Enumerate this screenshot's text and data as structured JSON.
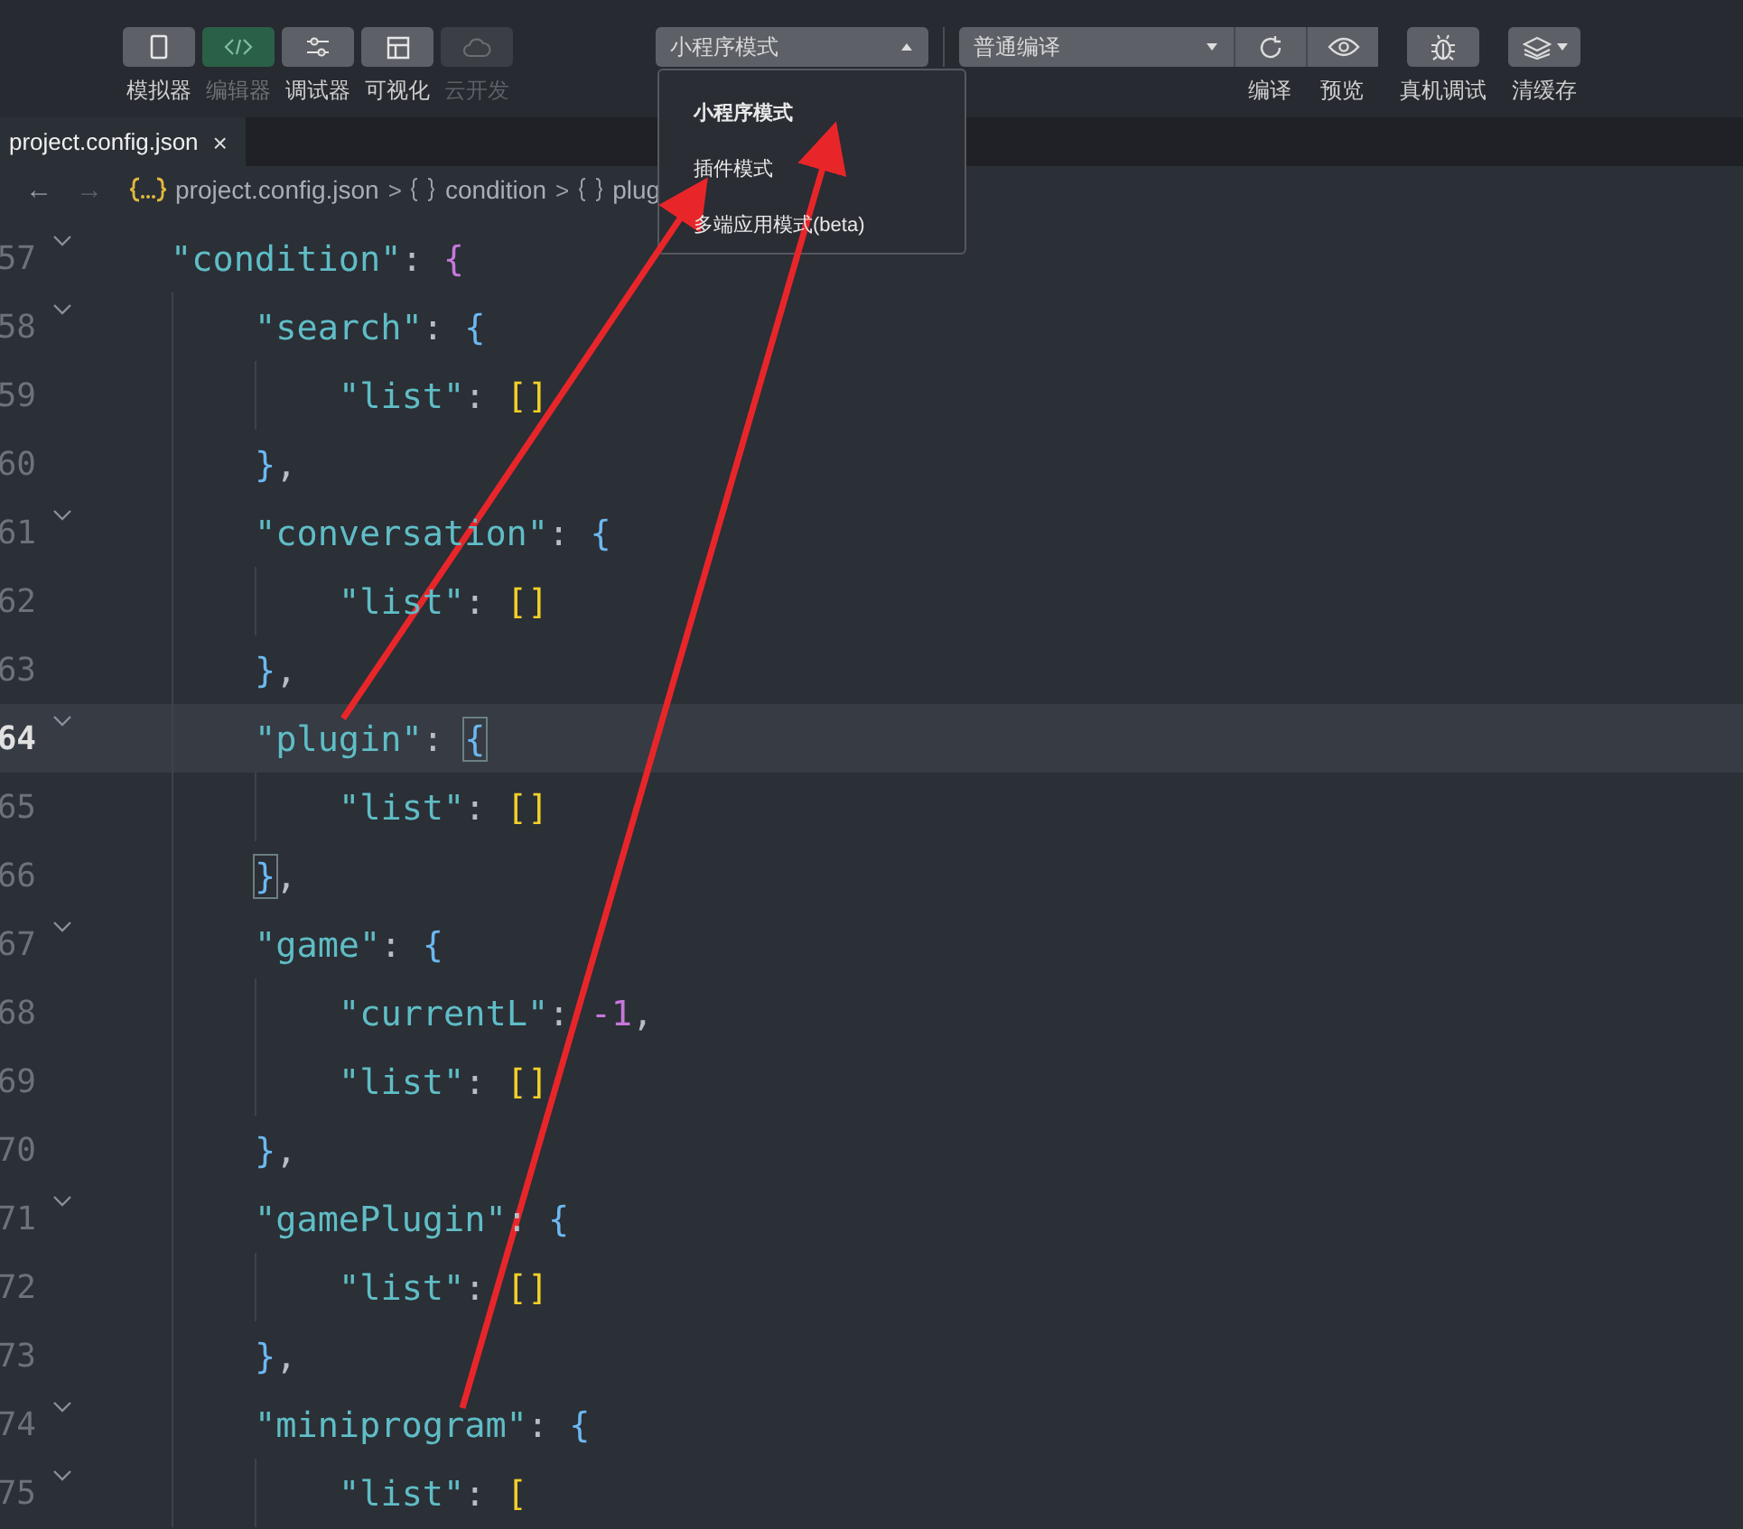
{
  "toolbar": {
    "view_buttons": [
      {
        "label": "模拟器",
        "on": false,
        "disabled": false
      },
      {
        "label": "编辑器",
        "on": true,
        "disabled": false
      },
      {
        "label": "调试器",
        "on": false,
        "disabled": false
      },
      {
        "label": "可视化",
        "on": false,
        "disabled": false
      },
      {
        "label": "云开发",
        "on": false,
        "disabled": true
      }
    ],
    "mode_select": {
      "value": "小程序模式",
      "expanded": true
    },
    "compile_select": {
      "value": "普通编译"
    },
    "actions": [
      {
        "label": "编译"
      },
      {
        "label": "预览"
      },
      {
        "label": "真机调试"
      },
      {
        "label": "清缓存"
      }
    ]
  },
  "mode_menu": {
    "items": [
      {
        "label": "小程序模式",
        "selected": true
      },
      {
        "label": "插件模式",
        "selected": false
      },
      {
        "label": "多端应用模式(beta)",
        "selected": false
      }
    ]
  },
  "tabs": [
    {
      "label": "project.config.json",
      "selected": true,
      "close": "×"
    }
  ],
  "breadcrumb": {
    "back": "←",
    "forward": "→",
    "items": [
      {
        "kind": "file",
        "label": "project.config.json"
      },
      {
        "kind": "object",
        "label": "condition"
      },
      {
        "kind": "object",
        "label": "plug"
      }
    ],
    "separator": ">"
  },
  "editor": {
    "lines": [
      {
        "number": "57",
        "fold": true,
        "current": false,
        "tokens": [
          {
            "kind": "key",
            "text": "\"condition\""
          },
          {
            "kind": "punct",
            "text": ": "
          },
          {
            "kind": "brace",
            "text": "{",
            "color": "#c678dd",
            "matched": false
          }
        ],
        "children": [
          {
            "number": "58",
            "fold": true,
            "current": false,
            "tokens": [
              {
                "kind": "key",
                "text": "\"search\""
              },
              {
                "kind": "punct",
                "text": ": "
              },
              {
                "kind": "brace",
                "text": "{",
                "color": "#6cb8f0",
                "matched": false
              }
            ],
            "children": [
              {
                "number": "59",
                "fold": false,
                "current": false,
                "tokens": [
                  {
                    "kind": "key",
                    "text": "\"list\""
                  },
                  {
                    "kind": "punct",
                    "text": ": "
                  },
                  {
                    "kind": "brace",
                    "text": "[]",
                    "color": "#f2d02a",
                    "matched": false
                  }
                ]
              }
            ]
          },
          {
            "number": "60",
            "fold": false,
            "current": false,
            "tokens": [
              {
                "kind": "brace",
                "text": "}",
                "color": "#6cb8f0",
                "matched": false
              },
              {
                "kind": "punct",
                "text": ","
              }
            ]
          },
          {
            "number": "61",
            "fold": true,
            "current": false,
            "tokens": [
              {
                "kind": "key",
                "text": "\"conversation\""
              },
              {
                "kind": "punct",
                "text": ": "
              },
              {
                "kind": "brace",
                "text": "{",
                "color": "#6cb8f0",
                "matched": false
              }
            ],
            "children": [
              {
                "number": "62",
                "fold": false,
                "current": false,
                "tokens": [
                  {
                    "kind": "key",
                    "text": "\"list\""
                  },
                  {
                    "kind": "punct",
                    "text": ": "
                  },
                  {
                    "kind": "brace",
                    "text": "[]",
                    "color": "#f2d02a",
                    "matched": false
                  }
                ]
              }
            ]
          },
          {
            "number": "63",
            "fold": false,
            "current": false,
            "tokens": [
              {
                "kind": "brace",
                "text": "}",
                "color": "#6cb8f0",
                "matched": false
              },
              {
                "kind": "punct",
                "text": ","
              }
            ]
          },
          {
            "number": "64",
            "fold": true,
            "current": true,
            "tokens": [
              {
                "kind": "key",
                "text": "\"plugin\""
              },
              {
                "kind": "punct",
                "text": ": "
              },
              {
                "kind": "brace",
                "text": "{",
                "color": "#6cb8f0",
                "matched": true
              }
            ],
            "children": [
              {
                "number": "65",
                "fold": false,
                "current": false,
                "tokens": [
                  {
                    "kind": "key",
                    "text": "\"list\""
                  },
                  {
                    "kind": "punct",
                    "text": ": "
                  },
                  {
                    "kind": "brace",
                    "text": "[]",
                    "color": "#f2d02a",
                    "matched": false
                  }
                ]
              }
            ]
          },
          {
            "number": "66",
            "fold": false,
            "current": false,
            "tokens": [
              {
                "kind": "brace",
                "text": "}",
                "color": "#6cb8f0",
                "matched": true
              },
              {
                "kind": "punct",
                "text": ","
              }
            ]
          },
          {
            "number": "67",
            "fold": true,
            "current": false,
            "tokens": [
              {
                "kind": "key",
                "text": "\"game\""
              },
              {
                "kind": "punct",
                "text": ": "
              },
              {
                "kind": "brace",
                "text": "{",
                "color": "#6cb8f0",
                "matched": false
              }
            ],
            "children": [
              {
                "number": "68",
                "fold": false,
                "current": false,
                "tokens": [
                  {
                    "kind": "key",
                    "text": "\"currentL\""
                  },
                  {
                    "kind": "punct",
                    "text": ": "
                  },
                  {
                    "kind": "number",
                    "text": "-1"
                  },
                  {
                    "kind": "punct",
                    "text": ","
                  }
                ]
              },
              {
                "number": "69",
                "fold": false,
                "current": false,
                "tokens": [
                  {
                    "kind": "key",
                    "text": "\"list\""
                  },
                  {
                    "kind": "punct",
                    "text": ": "
                  },
                  {
                    "kind": "brace",
                    "text": "[]",
                    "color": "#f2d02a",
                    "matched": false
                  }
                ]
              }
            ]
          },
          {
            "number": "70",
            "fold": false,
            "current": false,
            "tokens": [
              {
                "kind": "brace",
                "text": "}",
                "color": "#6cb8f0",
                "matched": false
              },
              {
                "kind": "punct",
                "text": ","
              }
            ]
          },
          {
            "number": "71",
            "fold": true,
            "current": false,
            "tokens": [
              {
                "kind": "key",
                "text": "\"gamePlugin\""
              },
              {
                "kind": "punct",
                "text": ": "
              },
              {
                "kind": "brace",
                "text": "{",
                "color": "#6cb8f0",
                "matched": false
              }
            ],
            "children": [
              {
                "number": "72",
                "fold": false,
                "current": false,
                "tokens": [
                  {
                    "kind": "key",
                    "text": "\"list\""
                  },
                  {
                    "kind": "punct",
                    "text": ": "
                  },
                  {
                    "kind": "brace",
                    "text": "[]",
                    "color": "#f2d02a",
                    "matched": false
                  }
                ]
              }
            ]
          },
          {
            "number": "73",
            "fold": false,
            "current": false,
            "tokens": [
              {
                "kind": "brace",
                "text": "}",
                "color": "#6cb8f0",
                "matched": false
              },
              {
                "kind": "punct",
                "text": ","
              }
            ]
          },
          {
            "number": "74",
            "fold": true,
            "current": false,
            "tokens": [
              {
                "kind": "key",
                "text": "\"miniprogram\""
              },
              {
                "kind": "punct",
                "text": ": "
              },
              {
                "kind": "brace",
                "text": "{",
                "color": "#6cb8f0",
                "matched": false
              }
            ],
            "children": [
              {
                "number": "75",
                "fold": true,
                "current": false,
                "tokens": [
                  {
                    "kind": "key",
                    "text": "\"list\""
                  },
                  {
                    "kind": "punct",
                    "text": ": "
                  },
                  {
                    "kind": "brace",
                    "text": "[",
                    "color": "#f2d02a",
                    "matched": false
                  }
                ]
              }
            ]
          }
        ]
      }
    ]
  }
}
